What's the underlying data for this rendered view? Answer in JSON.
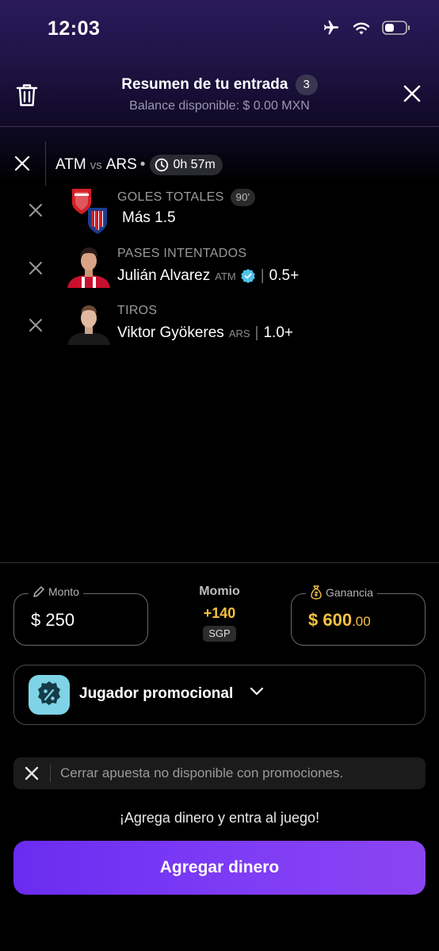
{
  "status_bar": {
    "time": "12:03"
  },
  "header": {
    "title": "Resumen de tu entrada",
    "count": "3",
    "subtitle": "Balance disponible: $ 0.00 MXN"
  },
  "match": {
    "home": "ATM",
    "vs": "vs",
    "away": "ARS",
    "separator": "•",
    "timer": "0h 57m"
  },
  "selections": [
    {
      "type": "GOLES TOTALES",
      "badge": "90'",
      "value": "Más 1.5",
      "icon": "team-crests"
    },
    {
      "type": "PASES INTENTADOS",
      "player": "Julián Alvarez",
      "team": "ATM",
      "value": "0.5+",
      "icon": "player-photo",
      "verified_icon": "verified-badge-icon"
    },
    {
      "type": "TIROS",
      "player": "Viktor Gyökeres",
      "team": "ARS",
      "value": "1.0+",
      "icon": "player-photo"
    }
  ],
  "stake": {
    "monto_label": "Monto",
    "monto_value": "$ 250",
    "momio_label": "Momio",
    "momio_value": "+140",
    "momio_tag": "SGP",
    "ganancia_label": "Ganancia",
    "ganancia_main": "$ 600",
    "ganancia_cents": ".00"
  },
  "promo": {
    "label": "Jugador promocional"
  },
  "notice": {
    "text": "Cerrar apuesta no disponible con promociones."
  },
  "cta": {
    "prompt": "¡Agrega dinero y entra al juego!",
    "button": "Agregar dinero"
  },
  "colors": {
    "accent": "#7a38f4",
    "gold": "#f6c13f",
    "promo_icon": "#7fd3e6"
  }
}
